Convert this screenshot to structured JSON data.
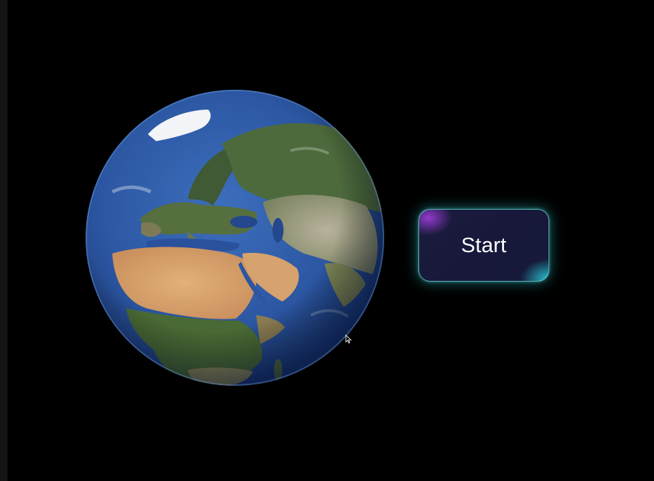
{
  "start_button": {
    "label": "Start"
  },
  "globe": {
    "icon": "earth-globe-europe-africa"
  },
  "pointer": {
    "icon": "mouse-cursor-icon"
  },
  "colors": {
    "background": "#000000",
    "button_fill": "#1b1b3d",
    "button_border": "#78e6e1",
    "button_glow": "#28aaaf",
    "accent_purple": "#963cd2",
    "accent_cyan": "#28c8d7",
    "ocean": "#2e5aa8",
    "desert": "#d9a06a",
    "land": "#4f6a3a"
  }
}
